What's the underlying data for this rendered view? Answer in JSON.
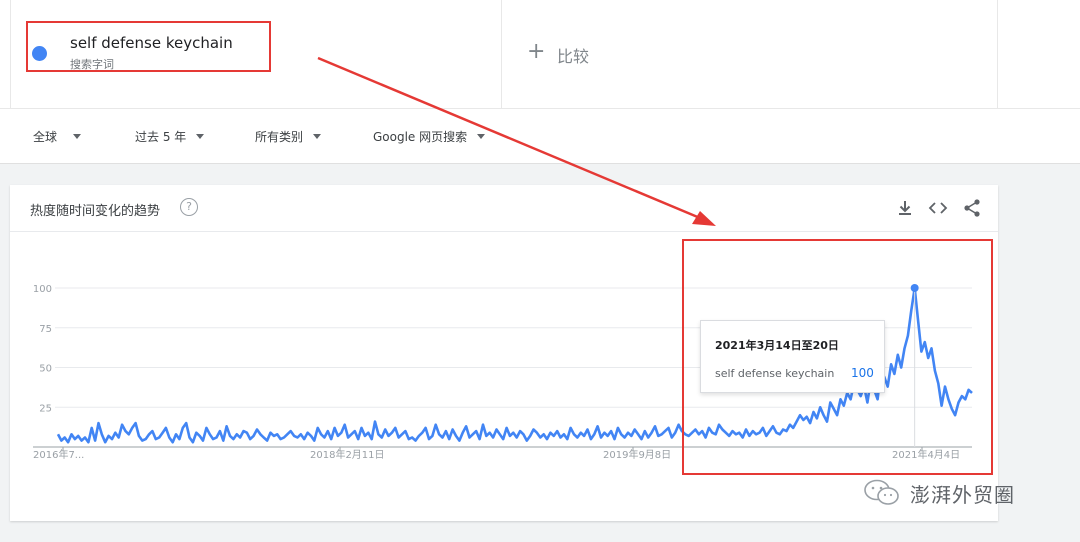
{
  "term": {
    "name": "self defense keychain",
    "subtitle": "搜索字词",
    "color": "#4285f4"
  },
  "compare": {
    "label": "比较",
    "icon": "plus-icon"
  },
  "filters": [
    {
      "label": "全球",
      "icon": "caret-down-icon"
    },
    {
      "label": "过去 5 年",
      "icon": "caret-down-icon"
    },
    {
      "label": "所有类别",
      "icon": "caret-down-icon"
    },
    {
      "label": "Google 网页搜索",
      "icon": "caret-down-icon"
    }
  ],
  "card": {
    "title": "热度随时间变化的趋势",
    "help_glyph": "?",
    "actions": [
      "download-icon",
      "embed-icon",
      "share-icon"
    ]
  },
  "tooltip": {
    "date": "2021年3月14日至20日",
    "term": "self defense keychain",
    "value": "100"
  },
  "watermark": {
    "text": "澎湃外贸圈",
    "icon": "wechat-icon"
  },
  "annotation_color": "#e53935",
  "chart_data": {
    "type": "line",
    "ylim": [
      0,
      100
    ],
    "yticks": [
      25,
      50,
      75,
      100
    ],
    "xticks": [
      "2016年7...",
      "2018年2月11日",
      "2019年9月8日",
      "2021年4月4日"
    ],
    "grid": true,
    "series": [
      {
        "color": "#4285f4",
        "values": [
          8,
          4,
          6,
          3,
          8,
          5,
          7,
          4,
          6,
          3,
          12,
          4,
          15,
          8,
          3,
          7,
          5,
          9,
          6,
          14,
          10,
          8,
          12,
          15,
          7,
          4,
          5,
          8,
          10,
          5,
          6,
          9,
          12,
          6,
          3,
          8,
          5,
          12,
          15,
          6,
          3,
          9,
          7,
          4,
          12,
          8,
          5,
          6,
          10,
          4,
          13,
          7,
          5,
          8,
          6,
          10,
          9,
          5,
          7,
          11,
          8,
          6,
          4,
          9,
          7,
          8,
          5,
          6,
          8,
          10,
          7,
          6,
          8,
          5,
          9,
          7,
          4,
          12,
          8,
          6,
          10,
          5,
          12,
          7,
          9,
          14,
          6,
          8,
          10,
          5,
          12,
          7,
          9,
          5,
          16,
          8,
          6,
          11,
          7,
          9,
          12,
          6,
          8,
          10,
          5,
          6,
          4,
          7,
          9,
          12,
          5,
          7,
          14,
          8,
          6,
          10,
          5,
          11,
          7,
          4,
          9,
          13,
          6,
          8,
          10,
          5,
          14,
          7,
          9,
          6,
          11,
          8,
          5,
          12,
          7,
          9,
          6,
          10,
          8,
          4,
          7,
          11,
          9,
          6,
          8,
          5,
          9,
          7,
          10,
          6,
          8,
          5,
          12,
          8,
          6,
          9,
          7,
          11,
          5,
          8,
          13,
          6,
          9,
          7,
          10,
          5,
          12,
          8,
          6,
          9,
          7,
          11,
          8,
          5,
          10,
          6,
          9,
          13,
          7,
          8,
          10,
          12,
          6,
          9,
          14,
          10,
          8,
          7,
          9,
          11,
          8,
          10,
          6,
          12,
          9,
          8,
          14,
          11,
          9,
          7,
          10,
          8,
          9,
          6,
          11,
          7,
          10,
          8,
          9,
          12,
          7,
          10,
          13,
          9,
          8,
          11,
          10,
          14,
          12,
          16,
          20,
          17,
          19,
          15,
          22,
          18,
          25,
          20,
          16,
          28,
          24,
          20,
          30,
          26,
          34,
          30,
          40,
          36,
          32,
          38,
          28,
          42,
          36,
          30,
          48,
          44,
          38,
          52,
          46,
          58,
          50,
          62,
          70,
          86,
          100,
          80,
          60,
          66,
          56,
          62,
          48,
          40,
          26,
          38,
          30,
          24,
          20,
          28,
          32,
          30,
          36,
          34
        ]
      }
    ],
    "highlight": {
      "x": "2021年3月14日至20日",
      "y": 100
    }
  }
}
